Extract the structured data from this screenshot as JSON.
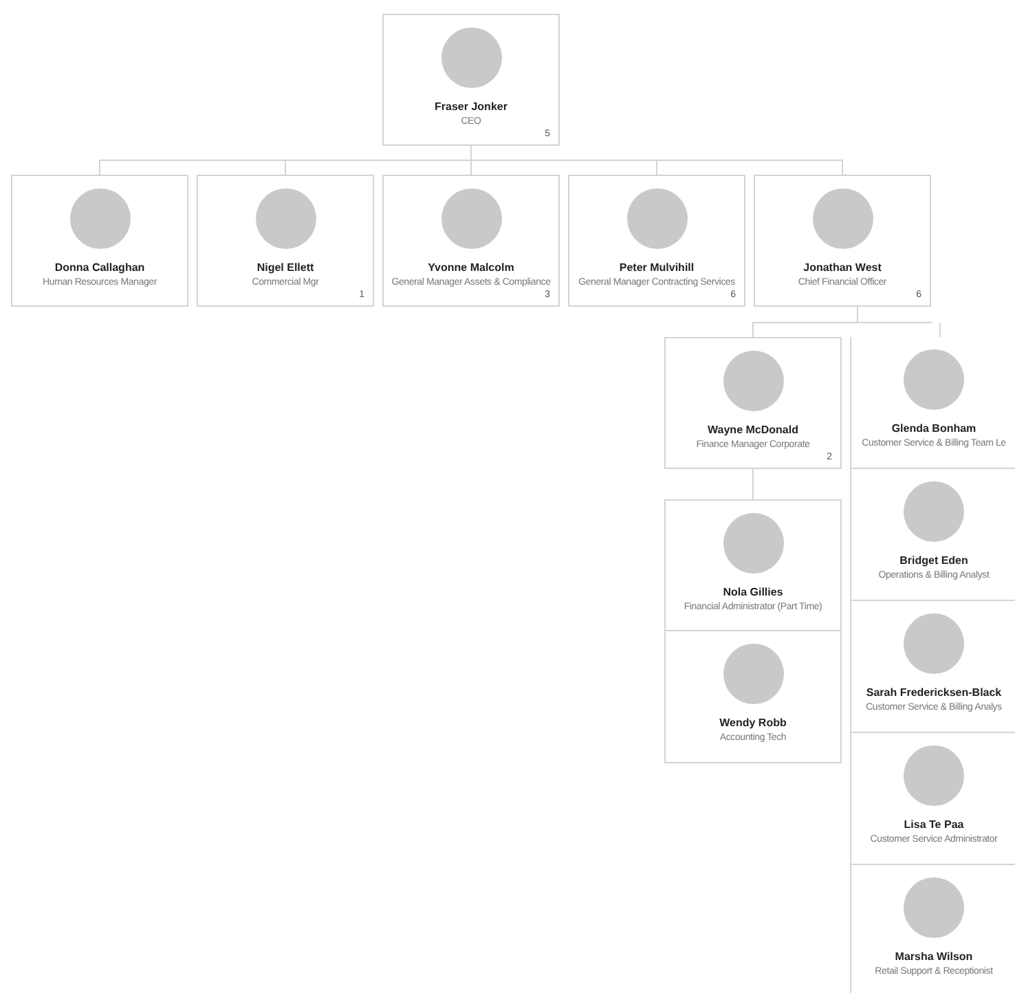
{
  "root": {
    "name": "Fraser Jonker",
    "title": "CEO",
    "count": "5",
    "children": [
      {
        "name": "Donna Callaghan",
        "title": "Human Resources Manager"
      },
      {
        "name": "Nigel Ellett",
        "title": "Commercial Mgr",
        "count": "1"
      },
      {
        "name": "Yvonne Malcolm",
        "title": "General Manager Assets & Compliance",
        "count": "3"
      },
      {
        "name": "Peter Mulvihill",
        "title": "General Manager Contracting Services",
        "count": "6"
      },
      {
        "name": "Jonathan West",
        "title": "Chief Financial Officer",
        "count": "6",
        "children": [
          {
            "name": "Wayne McDonald",
            "title": "Finance Manager Corporate",
            "count": "2",
            "children": [
              {
                "name": "Nola Gillies",
                "title": "Financial Administrator (Part Time)"
              },
              {
                "name": "Wendy Robb",
                "title": "Accounting Tech"
              }
            ]
          },
          {
            "name": "Glenda Bonham",
            "title": "Customer Service & Billing Team Le"
          },
          {
            "name": "Bridget Eden",
            "title": "Operations & Billing Analyst"
          },
          {
            "name": "Sarah Fredericksen-Black",
            "title": "Customer Service & Billing Analys"
          },
          {
            "name": "Lisa Te Paa",
            "title": "Customer Service Administrator"
          },
          {
            "name": "Marsha Wilson",
            "title": "Retail Support & Receptionist"
          }
        ]
      }
    ]
  }
}
